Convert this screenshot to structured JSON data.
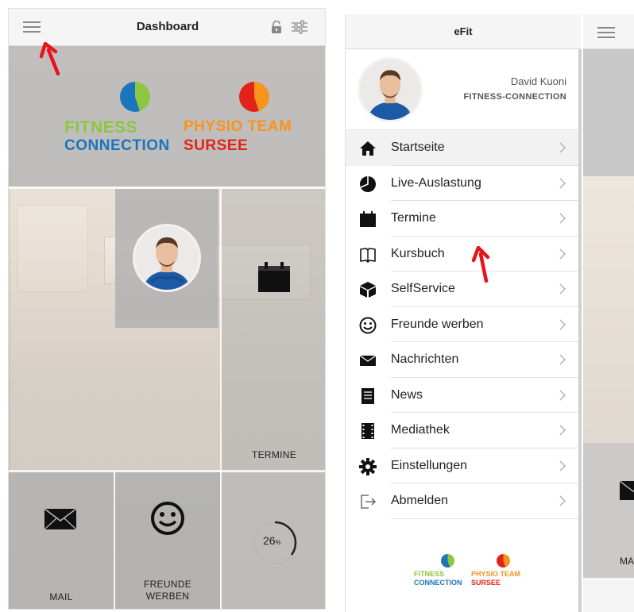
{
  "left": {
    "header": {
      "title": "Dashboard"
    },
    "logos": {
      "fitness": {
        "line1": "FITNESS",
        "line2": "CONNECTION"
      },
      "physio": {
        "line1": "PHYSIO TEAM",
        "line2": "SURSEE"
      }
    },
    "tiles": {
      "termine": "TERMINE",
      "mail": "MAIL",
      "freunde_line1": "FREUNDE",
      "freunde_line2": "WERBEN",
      "auslastung_value": "26",
      "auslastung_unit": "%"
    }
  },
  "right": {
    "header": {
      "title": "eFit"
    },
    "profile": {
      "name": "David Kuoni",
      "org": "FITNESS-CONNECTION"
    },
    "menu": [
      {
        "label": "Startseite",
        "icon": "home-icon",
        "active": true
      },
      {
        "label": "Live-Auslastung",
        "icon": "pie-chart-icon",
        "active": false
      },
      {
        "label": "Termine",
        "icon": "calendar-icon",
        "active": false
      },
      {
        "label": "Kursbuch",
        "icon": "book-icon",
        "active": false
      },
      {
        "label": "SelfService",
        "icon": "box-icon",
        "active": false
      },
      {
        "label": "Freunde werben",
        "icon": "smiley-icon",
        "active": false
      },
      {
        "label": "Nachrichten",
        "icon": "envelope-icon",
        "active": false
      },
      {
        "label": "News",
        "icon": "news-icon",
        "active": false
      },
      {
        "label": "Mediathek",
        "icon": "film-icon",
        "active": false
      },
      {
        "label": "Einstellungen",
        "icon": "gear-icon",
        "active": false
      },
      {
        "label": "Abmelden",
        "icon": "logout-icon",
        "active": false
      }
    ],
    "footer_logos": {
      "fitness": {
        "line1": "FITNESS",
        "line2": "CONNECTION"
      },
      "physio": {
        "line1": "PHYSIO TEAM",
        "line2": "SURSEE"
      }
    },
    "behind_labels": {
      "mail": "MA"
    }
  },
  "colors": {
    "fitness_green": "#8dc63f",
    "fitness_blue": "#1b75bc",
    "physio_orange": "#f7941d",
    "physio_red": "#e2231a",
    "annotation_red": "#e8141b"
  }
}
